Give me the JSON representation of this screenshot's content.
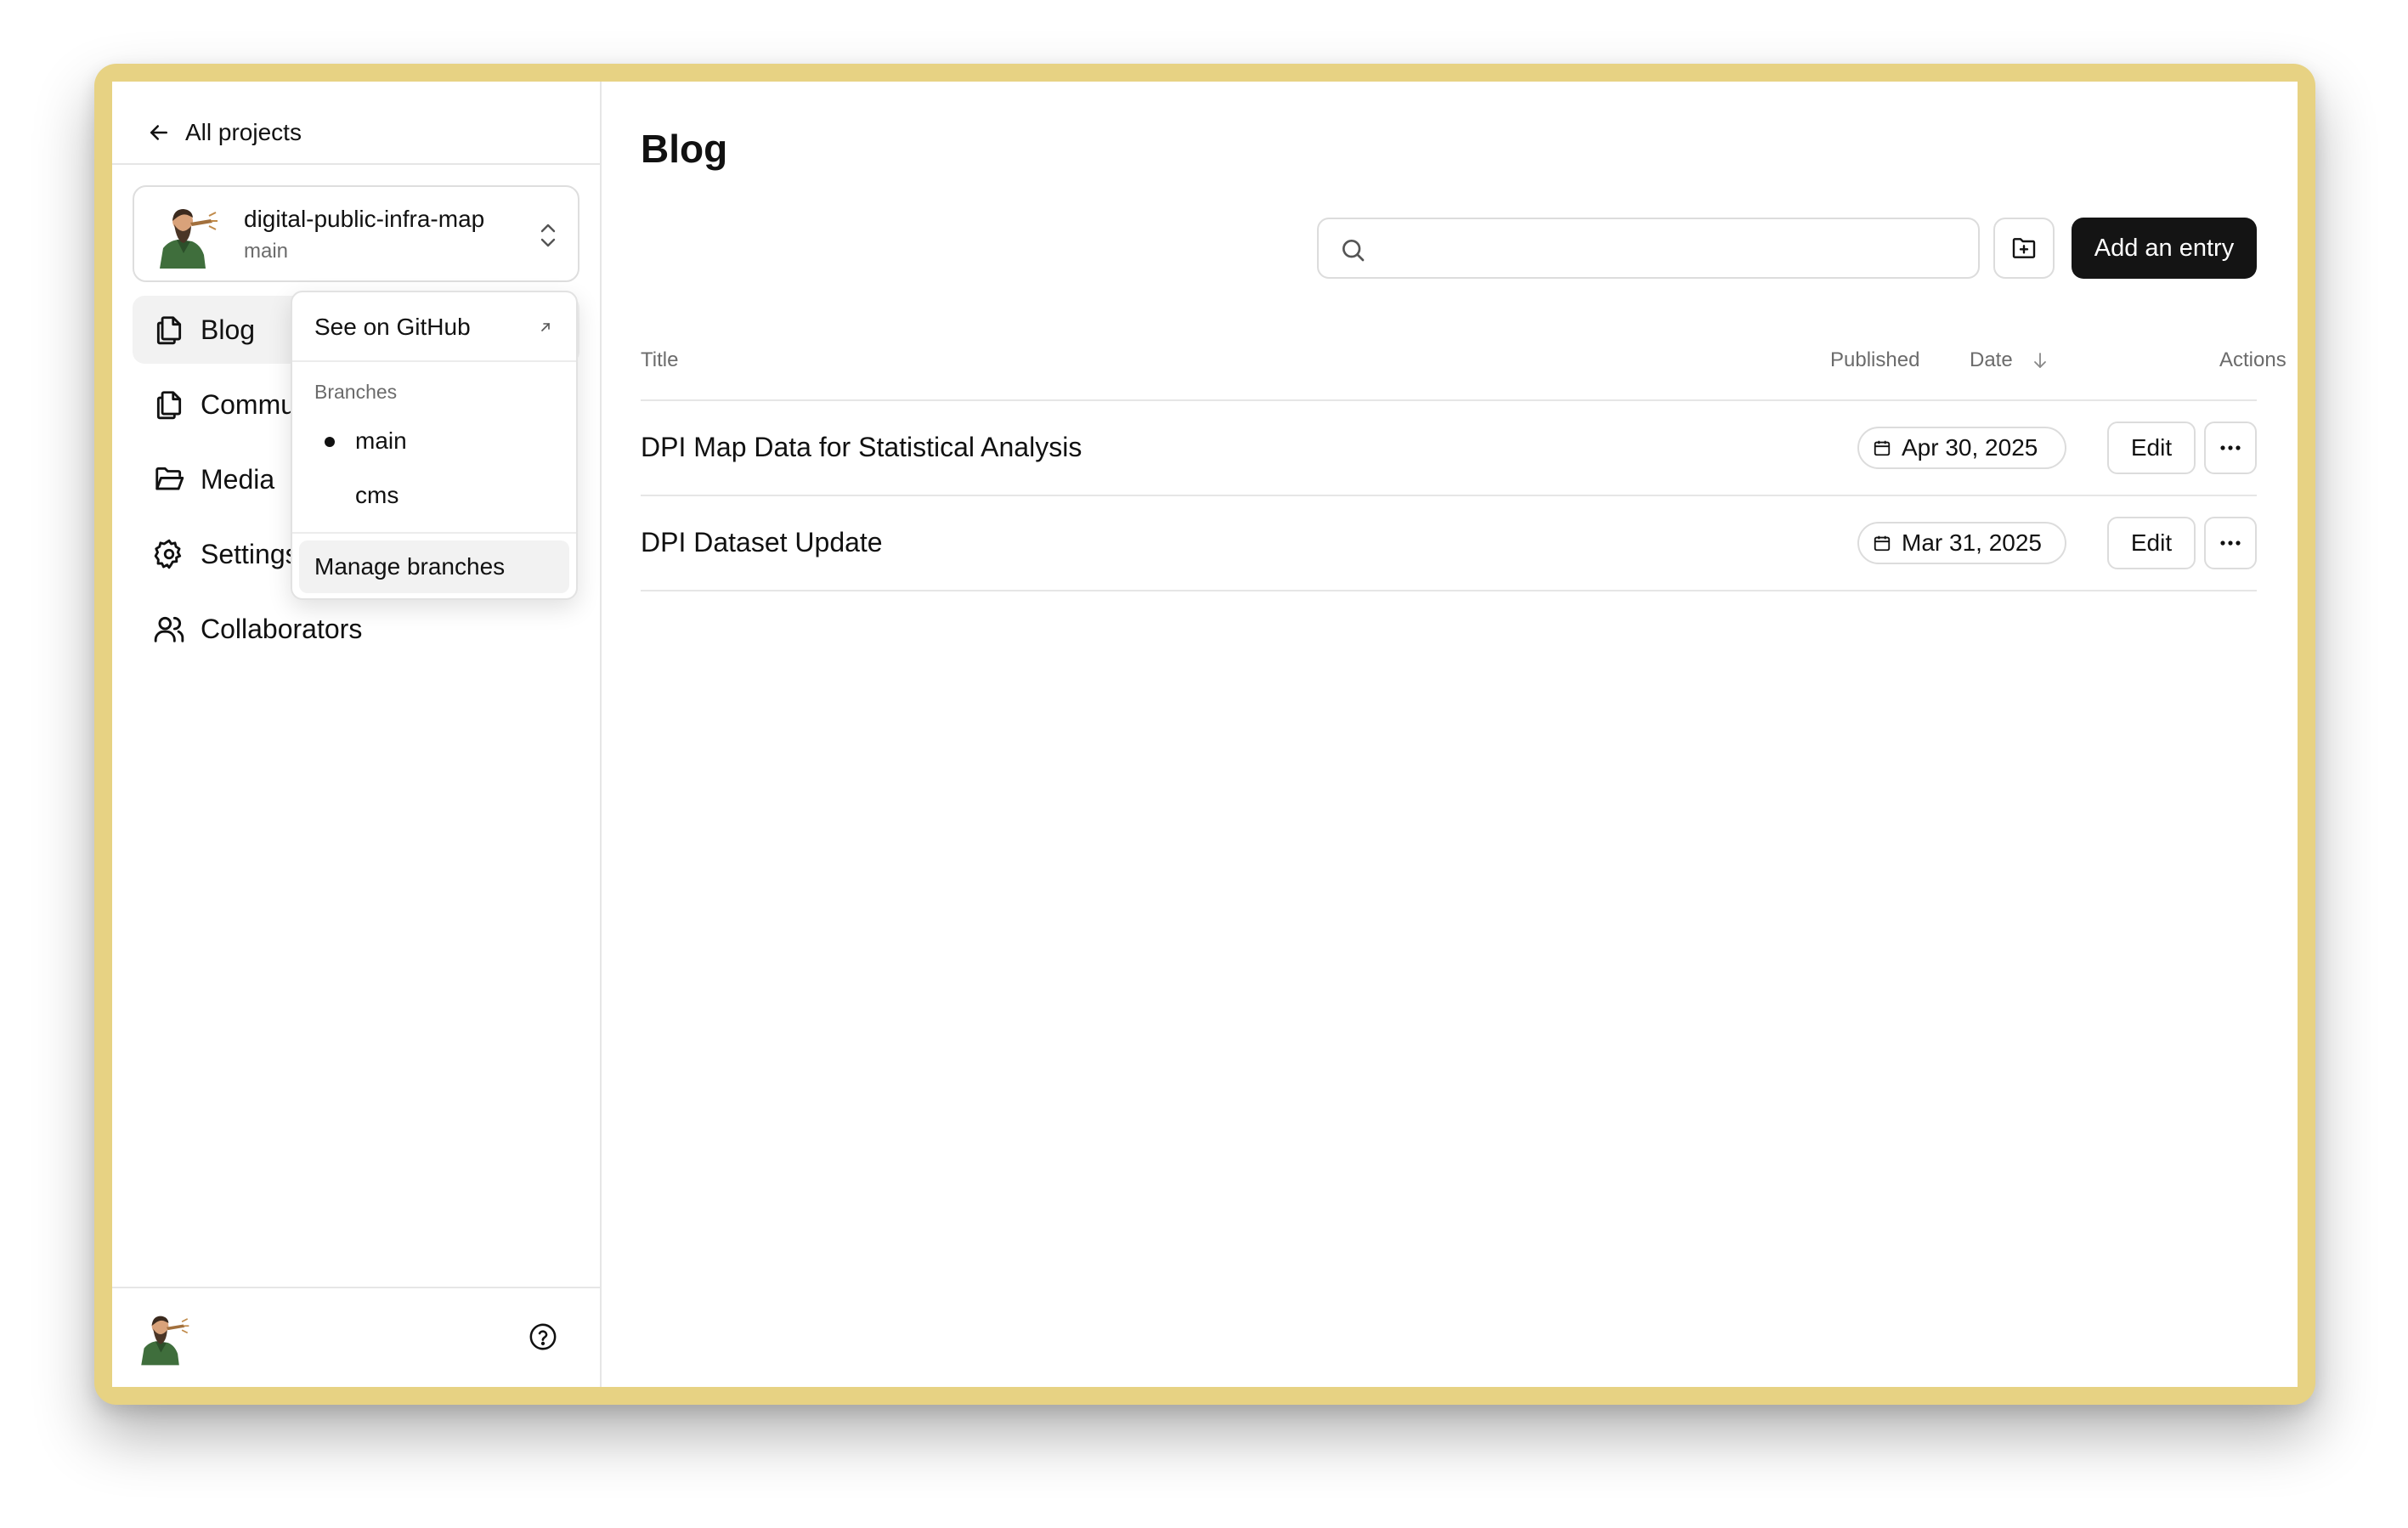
{
  "sidebar": {
    "back_label": "All projects",
    "project": {
      "name": "digital-public-infra-map",
      "branch": "main"
    },
    "nav": [
      {
        "label": "Blog",
        "icon": "copy-icon"
      },
      {
        "label": "Community",
        "icon": "copy-icon"
      },
      {
        "label": "Media",
        "icon": "folder-open-icon"
      },
      {
        "label": "Settings",
        "icon": "gear-icon"
      },
      {
        "label": "Collaborators",
        "icon": "users-icon"
      }
    ]
  },
  "dropdown": {
    "github_label": "See on GitHub",
    "branches_heading": "Branches",
    "branches": [
      "main",
      "cms"
    ],
    "selected_branch": "main",
    "manage_label": "Manage branches"
  },
  "main": {
    "title": "Blog",
    "search": {
      "value": "",
      "placeholder": ""
    },
    "add_label": "Add an entry",
    "table": {
      "columns": {
        "title": "Title",
        "published": "Published",
        "date": "Date",
        "actions": "Actions"
      },
      "rows": [
        {
          "title": "DPI Map Data for Statistical Analysis",
          "date": "Apr 30, 2025",
          "edit": "Edit"
        },
        {
          "title": "DPI Dataset Update",
          "date": "Mar 31, 2025",
          "edit": "Edit"
        }
      ]
    }
  },
  "colors": {
    "accent": "#141414",
    "frame": "#e7d283",
    "border": "#dcdcdc",
    "muted_text": "#6b6b6b"
  }
}
